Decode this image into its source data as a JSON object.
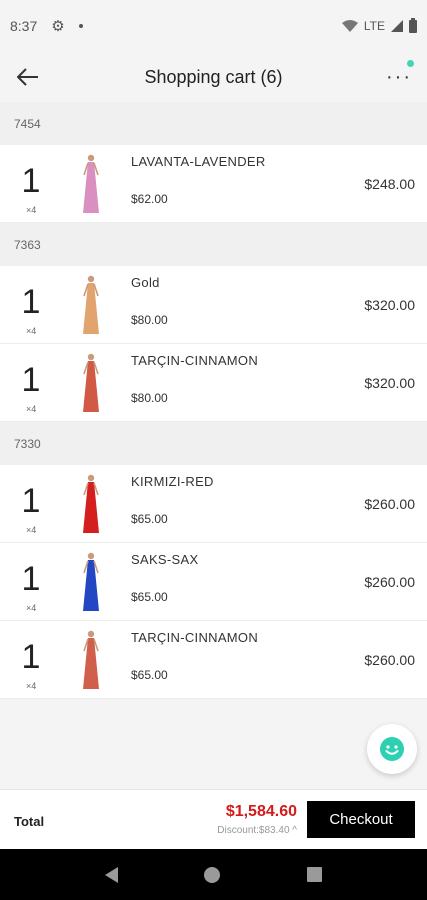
{
  "status_bar": {
    "time": "8:37",
    "network": "LTE"
  },
  "header": {
    "title": "Shopping cart (6)"
  },
  "groups": [
    {
      "code": "7454",
      "items": [
        {
          "qty": "1",
          "mult": "×4",
          "name": "LAVANTA-LAVENDER",
          "unit_price": "$62.00",
          "line_total": "$248.00",
          "dress_color": "#d98fc0"
        }
      ]
    },
    {
      "code": "7363",
      "items": [
        {
          "qty": "1",
          "mult": "×4",
          "name": "Gold",
          "unit_price": "$80.00",
          "line_total": "$320.00",
          "dress_color": "#e2a46e"
        },
        {
          "qty": "1",
          "mult": "×4",
          "name": "TARÇIN-CINNAMON",
          "unit_price": "$80.00",
          "line_total": "$320.00",
          "dress_color": "#d05a45"
        }
      ]
    },
    {
      "code": "7330",
      "items": [
        {
          "qty": "1",
          "mult": "×4",
          "name": "KIRMIZI-RED",
          "unit_price": "$65.00",
          "line_total": "$260.00",
          "dress_color": "#d41f1f"
        },
        {
          "qty": "1",
          "mult": "×4",
          "name": "SAKS-SAX",
          "unit_price": "$65.00",
          "line_total": "$260.00",
          "dress_color": "#2346c4"
        },
        {
          "qty": "1",
          "mult": "×4",
          "name": "TARÇIN-CINNAMON",
          "unit_price": "$65.00",
          "line_total": "$260.00",
          "dress_color": "#d0604b"
        }
      ]
    }
  ],
  "footer": {
    "total_label": "Total",
    "total_value": "$1,584.60",
    "discount": "Discount:$83.40 ^",
    "checkout_label": "Checkout"
  },
  "colors": {
    "accent_red": "#d41a1a",
    "badge": "#3fd6b8",
    "chat_icon": "#2dd0b0"
  }
}
